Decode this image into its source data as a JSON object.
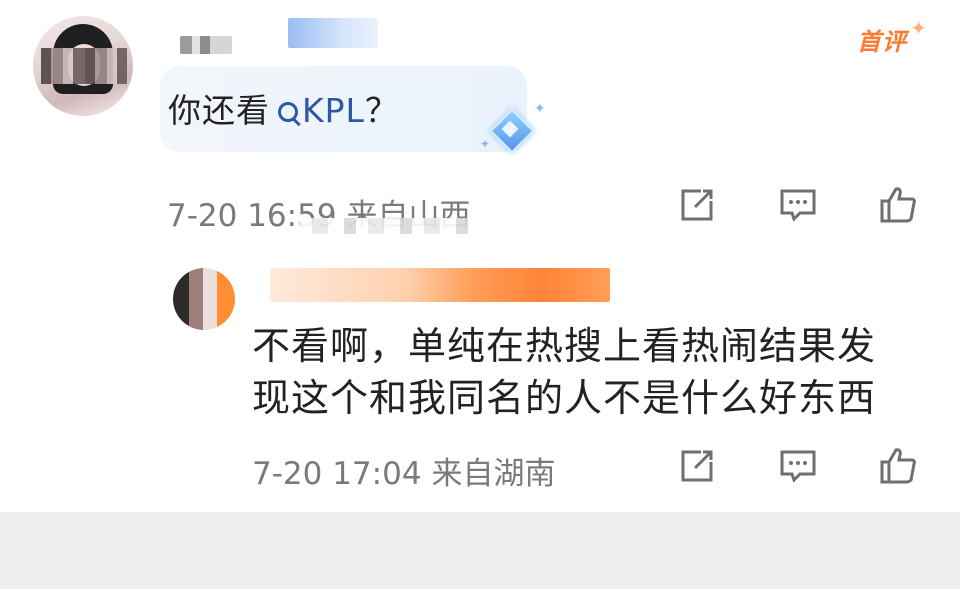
{
  "comment": {
    "badge": "首评",
    "text_prefix": "你还看",
    "search_term": "KPL",
    "text_suffix": "？",
    "date": "7-20 16:59",
    "location": "来自山西",
    "actions": {
      "share_icon": "share-icon",
      "comment_icon": "comment-icon",
      "like_icon": "like-icon"
    }
  },
  "reply": {
    "text": "不看啊，单纯在热搜上看热闹结果发现这个和我同名的人不是什么好东西",
    "date": "7-20 17:04",
    "location": "来自湖南"
  },
  "colors": {
    "accent_orange": "#ff7a2e",
    "link_blue": "#2e57a6",
    "gray_text": "#7a7a7a"
  }
}
